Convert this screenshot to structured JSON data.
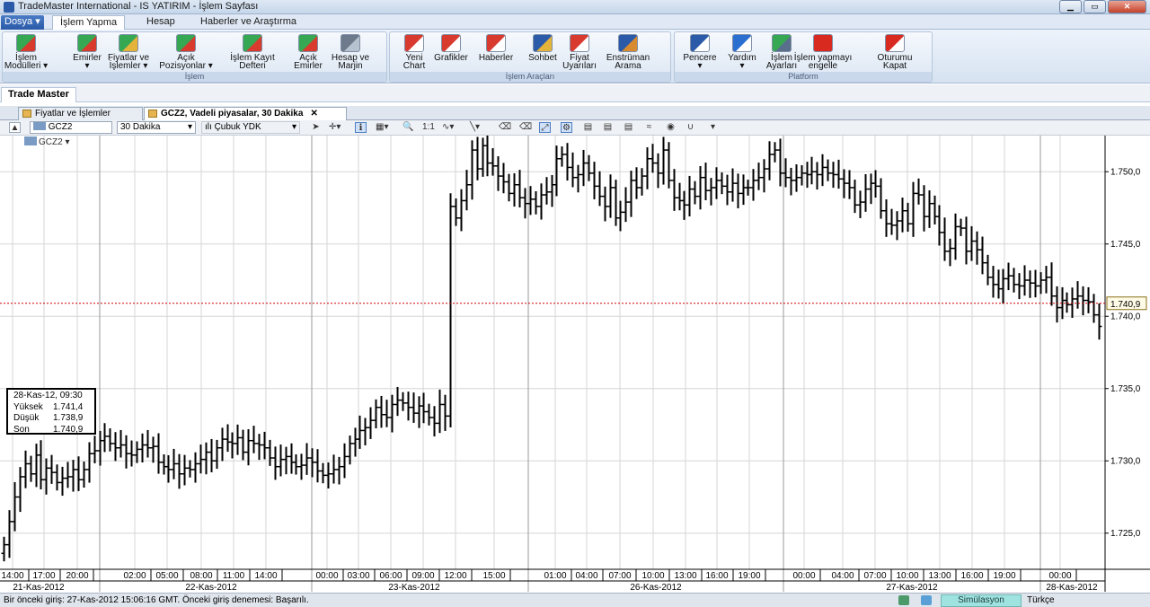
{
  "window": {
    "title": "TradeMaster International - IS YATIRIM - İşlem Sayfası"
  },
  "menu": {
    "file": "Dosya",
    "tabs": [
      "İşlem Yapma",
      "Hesap",
      "Haberler ve Araştırma"
    ]
  },
  "ribbon": {
    "groups": [
      {
        "name": "İşlem",
        "buttons": [
          {
            "l1": "İşlem",
            "l2": "Modülleri ▾",
            "icon": "arrows-up-down-icon"
          },
          {
            "l1": "Emirler",
            "l2": "▾",
            "icon": "order-arrows-icon"
          },
          {
            "l1": "Fiyatlar ve",
            "l2": "İşlemler ▾",
            "icon": "prices-icon"
          },
          {
            "l1": "Açık",
            "l2": "Pozisyonlar ▾",
            "icon": "open-positions-icon"
          },
          {
            "l1": "İşlem Kayıt",
            "l2": "Defteri",
            "icon": "trade-log-icon"
          },
          {
            "l1": "Açık",
            "l2": "Emirler",
            "icon": "open-orders-icon"
          },
          {
            "l1": "Hesap ve",
            "l2": "Marjin",
            "icon": "account-margin-icon"
          }
        ]
      },
      {
        "name": "İşlem Araçları",
        "buttons": [
          {
            "l1": "Yeni",
            "l2": "Chart",
            "icon": "new-chart-icon"
          },
          {
            "l1": "Grafikler",
            "l2": "",
            "icon": "charts-icon"
          },
          {
            "l1": "Haberler",
            "l2": "",
            "icon": "news-icon"
          },
          {
            "l1": "Sohbet",
            "l2": "",
            "icon": "chat-icon"
          },
          {
            "l1": "Fiyat",
            "l2": "Uyarıları",
            "icon": "price-alert-icon"
          },
          {
            "l1": "Enstrüman",
            "l2": "Arama",
            "icon": "instrument-search-icon"
          }
        ]
      },
      {
        "name": "Platform",
        "buttons": [
          {
            "l1": "Pencere",
            "l2": "▾",
            "icon": "window-icon"
          },
          {
            "l1": "Yardım",
            "l2": "▾",
            "icon": "help-icon"
          },
          {
            "l1": "İşlem",
            "l2": "Ayarları",
            "icon": "trade-settings-icon"
          },
          {
            "l1": "İşlem yapmayı",
            "l2": "engelle",
            "icon": "block-trading-icon"
          },
          {
            "l1": "Oturumu",
            "l2": "Kapat",
            "icon": "logout-icon"
          }
        ]
      }
    ]
  },
  "doc_tab": "Trade Master",
  "sub_tabs": [
    {
      "label": "Fiyatlar ve İşlemler"
    },
    {
      "label": "GCZ2, Vadeli piyasalar, 30 Dakika"
    }
  ],
  "chart_toolbar": {
    "symbol": "GCZ2",
    "interval": "30 Dakika",
    "chart_type": "Çubuk YDK"
  },
  "chart_symbol_tag": "GCZ2 ▾",
  "legend": {
    "title": "28-Kas-12, 09:30",
    "rows": [
      {
        "k": "Yüksek",
        "v": "1.741,4"
      },
      {
        "k": "Düşük",
        "v": "1.738,9"
      },
      {
        "k": "Son",
        "v": "1.740,9"
      }
    ]
  },
  "status": {
    "message": "Bir önceki giriş: 27-Kas-2012 15:06:16 GMT. Önceki giriş denemesi: Başarılı.",
    "mode": "Simülasyon",
    "language": "Türkçe"
  },
  "colors": {
    "bars": "#000000",
    "last_line": "#cc0000",
    "grid": "#d6d6d6",
    "last_label_bg": "#fffbe6"
  },
  "chart_data": {
    "type": "ohlc-bar",
    "symbol": "GCZ2",
    "interval": "30 Dakika",
    "last_value": "1.740,9",
    "ylim": [
      1722.5,
      1752.5
    ],
    "y_ticks": [
      "1.750,0",
      "1.745,0",
      "1.740,0",
      "1.735,0",
      "1.730,0",
      "1.725,0"
    ],
    "y_tick_values": [
      1750,
      1745,
      1740,
      1735,
      1730,
      1725
    ],
    "x_time_labels": [
      "14:00",
      "17:00",
      "20:00",
      "02:00",
      "05:00",
      "08:00",
      "11:00",
      "14:00",
      "00:00",
      "03:00",
      "06:00",
      "09:00",
      "12:00",
      "15:00",
      "01:00",
      "04:00",
      "07:00",
      "10:00",
      "13:00",
      "16:00",
      "19:00",
      "00:00",
      "04:00",
      "07:00",
      "10:00",
      "13:00",
      "16:00",
      "19:00",
      "00:00"
    ],
    "x_date_labels": [
      "21-Kas-2012",
      "22-Kas-2012",
      "23-Kas-2012",
      "26-Kas-2012",
      "27-Kas-2012",
      "28-Kas-2012"
    ],
    "values": [
      1724.2,
      1725.8,
      1727.5,
      1728.9,
      1729.8,
      1729.1,
      1730.4,
      1728.7,
      1729.5,
      1729.2,
      1728.5,
      1728.8,
      1728.9,
      1729.4,
      1728.7,
      1729.4,
      1730.5,
      1730.7,
      1731.4,
      1731.7,
      1731.2,
      1730.9,
      1731.1,
      1730.5,
      1730.4,
      1730.8,
      1731.1,
      1730.9,
      1731.0,
      1729.9,
      1729.6,
      1729.4,
      1729.8,
      1729.1,
      1729.5,
      1729.4,
      1729.8,
      1730.1,
      1730.6,
      1730.0,
      1730.9,
      1731.5,
      1731.3,
      1731.2,
      1731.6,
      1730.6,
      1731.4,
      1731.2,
      1731.1,
      1730.9,
      1730.2,
      1729.6,
      1730.1,
      1730.3,
      1729.9,
      1729.6,
      1729.7,
      1730.2,
      1729.9,
      1729.3,
      1729.0,
      1729.1,
      1729.4,
      1729.6,
      1730.3,
      1731.2,
      1731.5,
      1732.1,
      1732.3,
      1732.8,
      1733.7,
      1733.2,
      1733.0,
      1733.9,
      1734.2,
      1734.0,
      1733.7,
      1733.3,
      1733.8,
      1733.4,
      1733.0,
      1732.6,
      1733.9,
      1733.1,
      1747.6,
      1746.8,
      1748.0,
      1749.1,
      1751.5,
      1750.2,
      1751.8,
      1750.6,
      1750.4,
      1749.7,
      1749.3,
      1748.5,
      1749.1,
      1748.2,
      1747.8,
      1748.1,
      1747.6,
      1748.4,
      1748.6,
      1749.1,
      1750.9,
      1751.2,
      1750.3,
      1749.6,
      1749.8,
      1750.6,
      1749.9,
      1749.0,
      1748.3,
      1747.6,
      1748.9,
      1746.8,
      1747.2,
      1747.9,
      1749.4,
      1748.9,
      1749.7,
      1750.9,
      1750.6,
      1749.9,
      1751.5,
      1749.4,
      1748.2,
      1748.0,
      1747.7,
      1748.8,
      1748.3,
      1749.6,
      1748.7,
      1748.9,
      1749.4,
      1749.0,
      1748.6,
      1749.2,
      1748.5,
      1748.9,
      1748.9,
      1749.4,
      1749.6,
      1750.2,
      1751.2,
      1751.5,
      1749.9,
      1749.6,
      1749.4,
      1749.6,
      1749.9,
      1749.8,
      1750.0,
      1749.8,
      1750.3,
      1749.9,
      1749.8,
      1749.5,
      1749.2,
      1748.9,
      1747.7,
      1747.9,
      1748.8,
      1749.2,
      1749.0,
      1747.3,
      1746.4,
      1746.3,
      1746.6,
      1747.3,
      1746.4,
      1748.5,
      1748.4,
      1746.9,
      1747.8,
      1746.9,
      1745.8,
      1744.5,
      1744.7,
      1746.2,
      1746.1,
      1744.5,
      1745.2,
      1744.6,
      1743.7,
      1742.7,
      1742.2,
      1741.9,
      1742.6,
      1742.8,
      1742.2,
      1742.1,
      1742.5,
      1742.3,
      1742.1,
      1742.5,
      1742.7,
      1741.4,
      1740.6,
      1741.1,
      1740.8,
      1741.2,
      1741.4,
      1741.1,
      1741.0,
      1740.1,
      1739.3
    ]
  }
}
